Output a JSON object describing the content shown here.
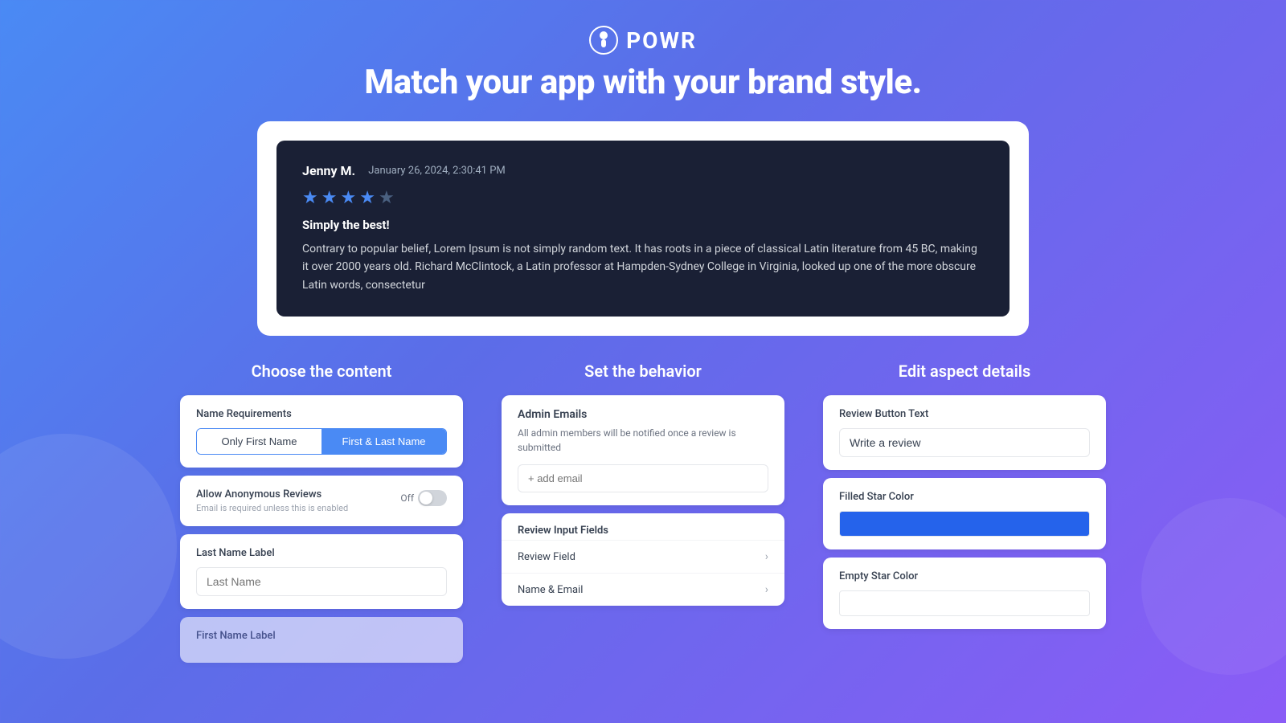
{
  "header": {
    "logo_text": "POWR",
    "tagline": "Match your app with your brand style."
  },
  "review": {
    "reviewer": "Jenny M.",
    "date": "January 26, 2024, 2:30:41 PM",
    "stars": 4,
    "title": "Simply the best!",
    "body": "Contrary to popular belief, Lorem Ipsum is not simply random text. It has roots in a piece of classical Latin literature from 45 BC, making it over 2000 years old. Richard McClintock, a Latin professor at Hampden-Sydney College in Virginia, looked up one of the more obscure Latin words, consectetur"
  },
  "content_section": {
    "title": "Choose the content",
    "name_requirements": {
      "label": "Name Requirements",
      "option1": "Only First Name",
      "option2": "First & Last Name"
    },
    "allow_anonymous": {
      "label": "Allow Anonymous Reviews",
      "sublabel": "Email is required unless this is enabled",
      "toggle_label": "Off"
    },
    "last_name_label": {
      "label": "Last Name Label",
      "placeholder": "Last Name"
    },
    "first_name_label": {
      "label": "First Name Label"
    }
  },
  "behavior_section": {
    "title": "Set the behavior",
    "admin_emails": {
      "title": "Admin Emails",
      "description": "All admin members will be notified once a review is submitted",
      "placeholder": "+ add email"
    },
    "review_input_fields": {
      "title": "Review Input Fields",
      "fields": [
        {
          "label": "Review Field"
        },
        {
          "label": "Name & Email"
        }
      ]
    }
  },
  "aspect_section": {
    "title": "Edit aspect details",
    "review_button_text": {
      "label": "Review Button Text",
      "value": "Write a review"
    },
    "filled_star_color": {
      "label": "Filled Star Color"
    },
    "empty_star_color": {
      "label": "Empty Star Color"
    }
  }
}
